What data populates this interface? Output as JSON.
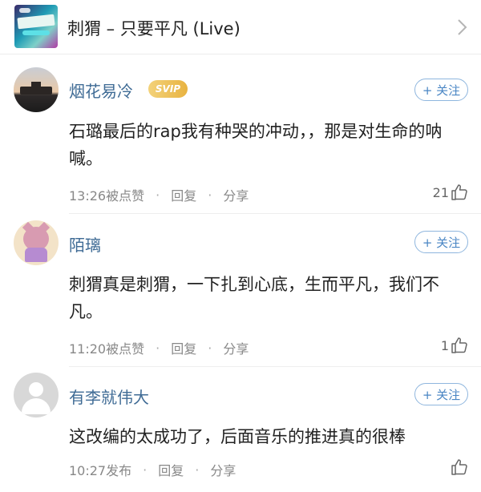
{
  "header": {
    "title": "刺猬 – 只要平凡 (Live)",
    "album_icon": "album-cover",
    "chevron_icon": "chevron-right-icon"
  },
  "comments": [
    {
      "user": "烟花易冷",
      "badge": "SVIP",
      "follow_label": "+ 关注",
      "text": "石璐最后的rap我有种哭的冲动，，那是对生命的呐喊。",
      "time": "13:26被点赞",
      "reply": "回复",
      "share": "分享",
      "likes": "21"
    },
    {
      "user": "陌璃",
      "follow_label": "+ 关注",
      "text": "刺猬真是刺猬，一下扎到心底，生而平凡，我们不凡。",
      "time": "11:20被点赞",
      "reply": "回复",
      "share": "分享",
      "likes": "1"
    },
    {
      "user": "有李就伟大",
      "follow_label": "+ 关注",
      "text": "这改编的太成功了，后面音乐的推进真的很棒",
      "time": "10:27发布",
      "reply": "回复",
      "share": "分享",
      "likes": ""
    }
  ],
  "separator": "·",
  "colors": {
    "username": "#3f6b95",
    "follow_border": "#8fb6de",
    "svip_gold": "#e8b341"
  }
}
